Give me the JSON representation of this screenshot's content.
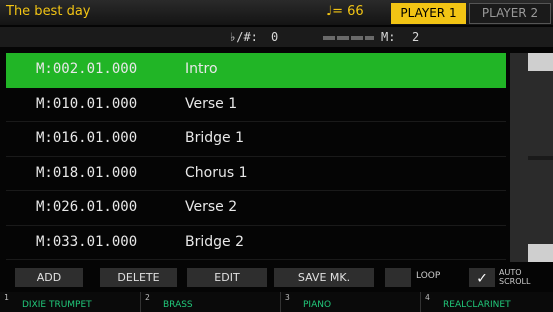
{
  "header": {
    "song_title": "The best day",
    "tempo": "♩= 66",
    "player1": "PLAYER 1",
    "player2": "PLAYER 2"
  },
  "info": {
    "accidentals_label": "♭/#:",
    "accidentals_value": "0",
    "meter_label": "M:",
    "meter_value": "2"
  },
  "markers": [
    {
      "position": "M:002.01.000",
      "name": "Intro",
      "selected": true
    },
    {
      "position": "M:010.01.000",
      "name": "Verse 1"
    },
    {
      "position": "M:016.01.000",
      "name": "Bridge 1"
    },
    {
      "position": "M:018.01.000",
      "name": "Chorus 1"
    },
    {
      "position": "M:026.01.000",
      "name": "Verse 2"
    },
    {
      "position": "M:033.01.000",
      "name": "Bridge 2"
    }
  ],
  "buttons": {
    "add": "ADD",
    "delete": "DELETE",
    "edit": "EDIT",
    "save": "SAVE MK.",
    "loop": "LOOP",
    "auto_scroll_line1": "AUTO",
    "auto_scroll_line2": "SCROLL",
    "auto_scroll_checked": true
  },
  "tracks": [
    {
      "num": "1",
      "name": "DIXIE TRUMPET"
    },
    {
      "num": "2",
      "name": "BRASS"
    },
    {
      "num": "3",
      "name": "PIANO"
    },
    {
      "num": "4",
      "name": "REALCLARINET"
    }
  ],
  "colors": {
    "accent": "#f2c414",
    "selected_row": "#21b526",
    "track_text": "#21c87a"
  }
}
